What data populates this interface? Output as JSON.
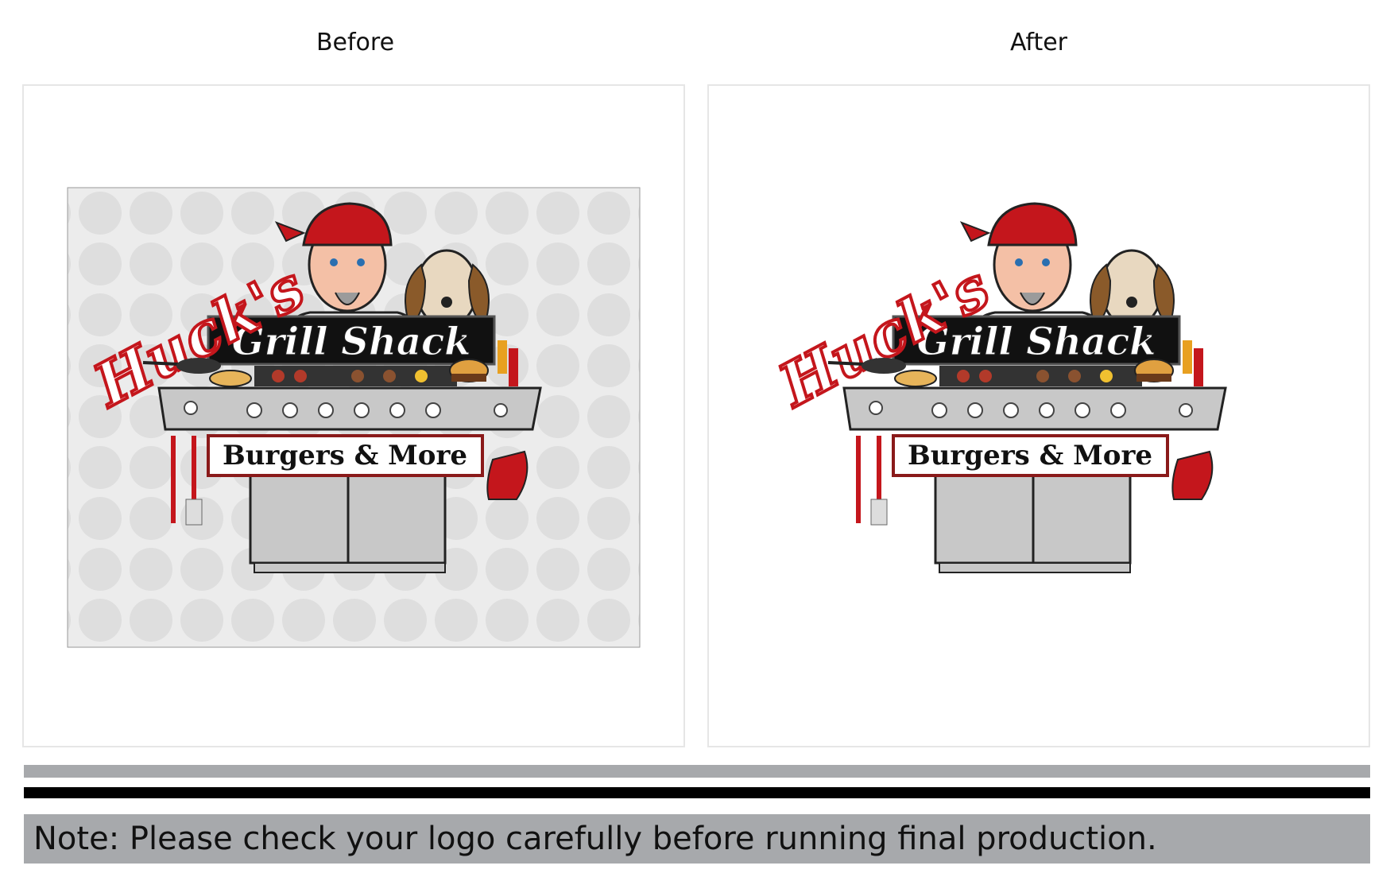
{
  "labels": {
    "before": "Before",
    "after": "After"
  },
  "logo": {
    "name_script": "Huck's",
    "banner_text": "Grill Shack",
    "tagline": "Burgers & More"
  },
  "note": "Note: Please check your logo carefully before running final production.",
  "colors": {
    "accent_red": "#c4161c",
    "banner_black": "#111111",
    "grill_gray": "#c8c8c8",
    "note_bar": "#a7a9ac",
    "before_bg": "#e9e9e9"
  },
  "icons": [
    "chef-character",
    "beagle-dog",
    "grill",
    "burger",
    "hotdog",
    "oven-mitt",
    "ketchup-bottle",
    "mustard-bottle",
    "fork",
    "spatula",
    "frying-pan"
  ]
}
